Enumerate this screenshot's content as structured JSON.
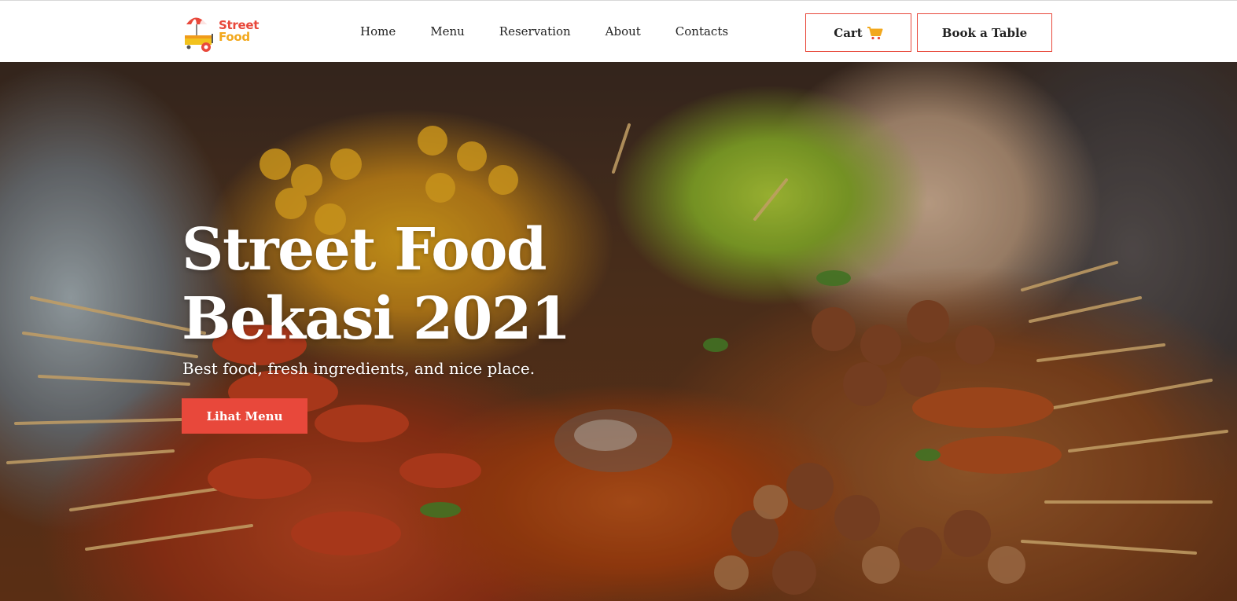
{
  "brand": {
    "line1": "Street",
    "line2": "Food",
    "icon": "food-cart-umbrella-logo"
  },
  "nav": {
    "items": [
      {
        "label": "Home"
      },
      {
        "label": "Menu"
      },
      {
        "label": "Reservation"
      },
      {
        "label": "About"
      },
      {
        "label": "Contacts"
      }
    ]
  },
  "header": {
    "cart_label": "Cart",
    "cart_icon": "shopping-cart-icon",
    "book_label": "Book a Table"
  },
  "hero": {
    "title_line1": "Street Food",
    "title_line2": "Bekasi 2021",
    "subtitle": "Best food, fresh ingredients, and nice place.",
    "cta_label": "Lihat Menu",
    "background": "street-food-skewers-photo"
  },
  "colors": {
    "accent": "#e8483b",
    "brand_red": "#e8483b",
    "brand_yellow": "#f2a81d",
    "text_dark": "#222222"
  }
}
